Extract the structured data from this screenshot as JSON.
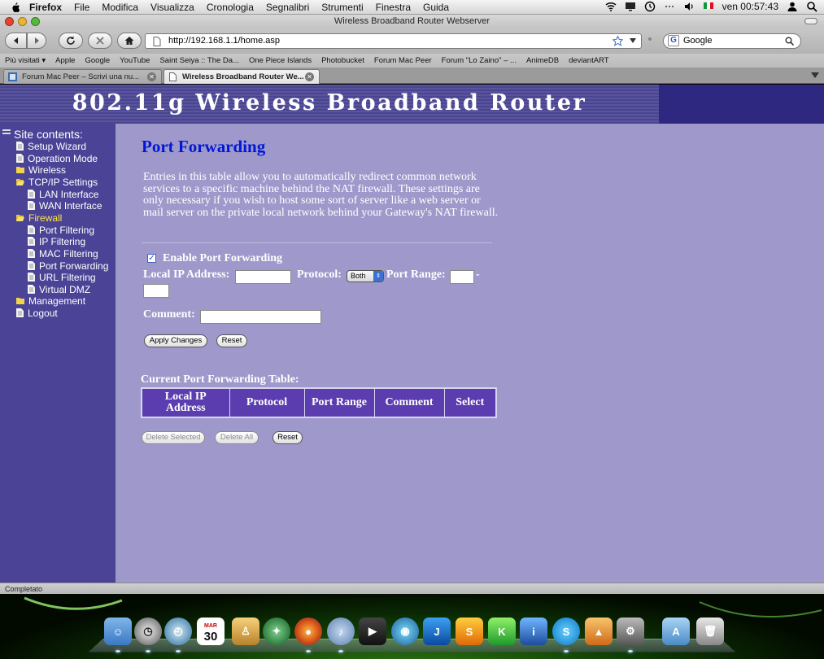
{
  "menubar": {
    "items": [
      "Firefox",
      "File",
      "Modifica",
      "Visualizza",
      "Cronologia",
      "Segnalibri",
      "Strumenti",
      "Finestra",
      "Guida"
    ],
    "clock": "ven 00:57:43"
  },
  "window": {
    "title": "Wireless Broadband Router Webserver"
  },
  "toolbar": {
    "url": "http://192.168.1.1/home.asp",
    "search_placeholder": "Google"
  },
  "bookmarks": [
    "Più visitati ▾",
    "Apple",
    "Google",
    "YouTube",
    "Saint Seiya :: The Da...",
    "One Piece Islands",
    "Photobucket",
    "Forum Mac Peer",
    "Forum \"Lo Zaino\" – ...",
    "AnimeDB",
    "deviantART"
  ],
  "tabs": [
    {
      "label": "Forum Mac Peer – Scrivi una nu...",
      "active": false
    },
    {
      "label": "Wireless Broadband Router We...",
      "active": true
    }
  ],
  "banner": {
    "title": "802.11g   Wireless   Broadband   Router"
  },
  "sidebar": {
    "heading": "Site contents:",
    "items": [
      {
        "label": "Setup Wizard"
      },
      {
        "label": "Operation Mode"
      },
      {
        "label": "Wireless"
      },
      {
        "label": "TCP/IP Settings"
      },
      {
        "label": "LAN Interface"
      },
      {
        "label": "WAN Interface"
      },
      {
        "label": "Firewall"
      },
      {
        "label": "Port Filtering"
      },
      {
        "label": "IP Filtering"
      },
      {
        "label": "MAC Filtering"
      },
      {
        "label": "Port Forwarding"
      },
      {
        "label": "URL Filtering"
      },
      {
        "label": "Virtual DMZ"
      },
      {
        "label": "Management"
      },
      {
        "label": "Logout"
      }
    ]
  },
  "main": {
    "title": "Port Forwarding",
    "description": "Entries in this table allow you to automatically redirect common network services to a specific machine behind the NAT firewall. These settings are only necessary if you wish to host some sort of server like a web server or mail server on the private local network behind your Gateway's NAT firewall.",
    "enable_label": "Enable Port Forwarding",
    "enable_checked": true,
    "local_ip_label": "Local IP Address:",
    "protocol_label": "Protocol:",
    "protocol_value": "Both",
    "port_range_label": "Port Range:",
    "port_range_dash": "-",
    "comment_label": "Comment:",
    "apply_button": "Apply Changes",
    "reset_button": "Reset",
    "table_title": "Current Port Forwarding Table:",
    "table_headers": [
      "Local IP Address",
      "Protocol",
      "Port Range",
      "Comment",
      "Select"
    ],
    "delete_selected_button": "Delete Selected",
    "delete_all_button": "Delete All",
    "reset2_button": "Reset"
  },
  "status": {
    "text": "Completato"
  },
  "dock": {
    "calendar_day": "30",
    "calendar_month": "MAR"
  }
}
